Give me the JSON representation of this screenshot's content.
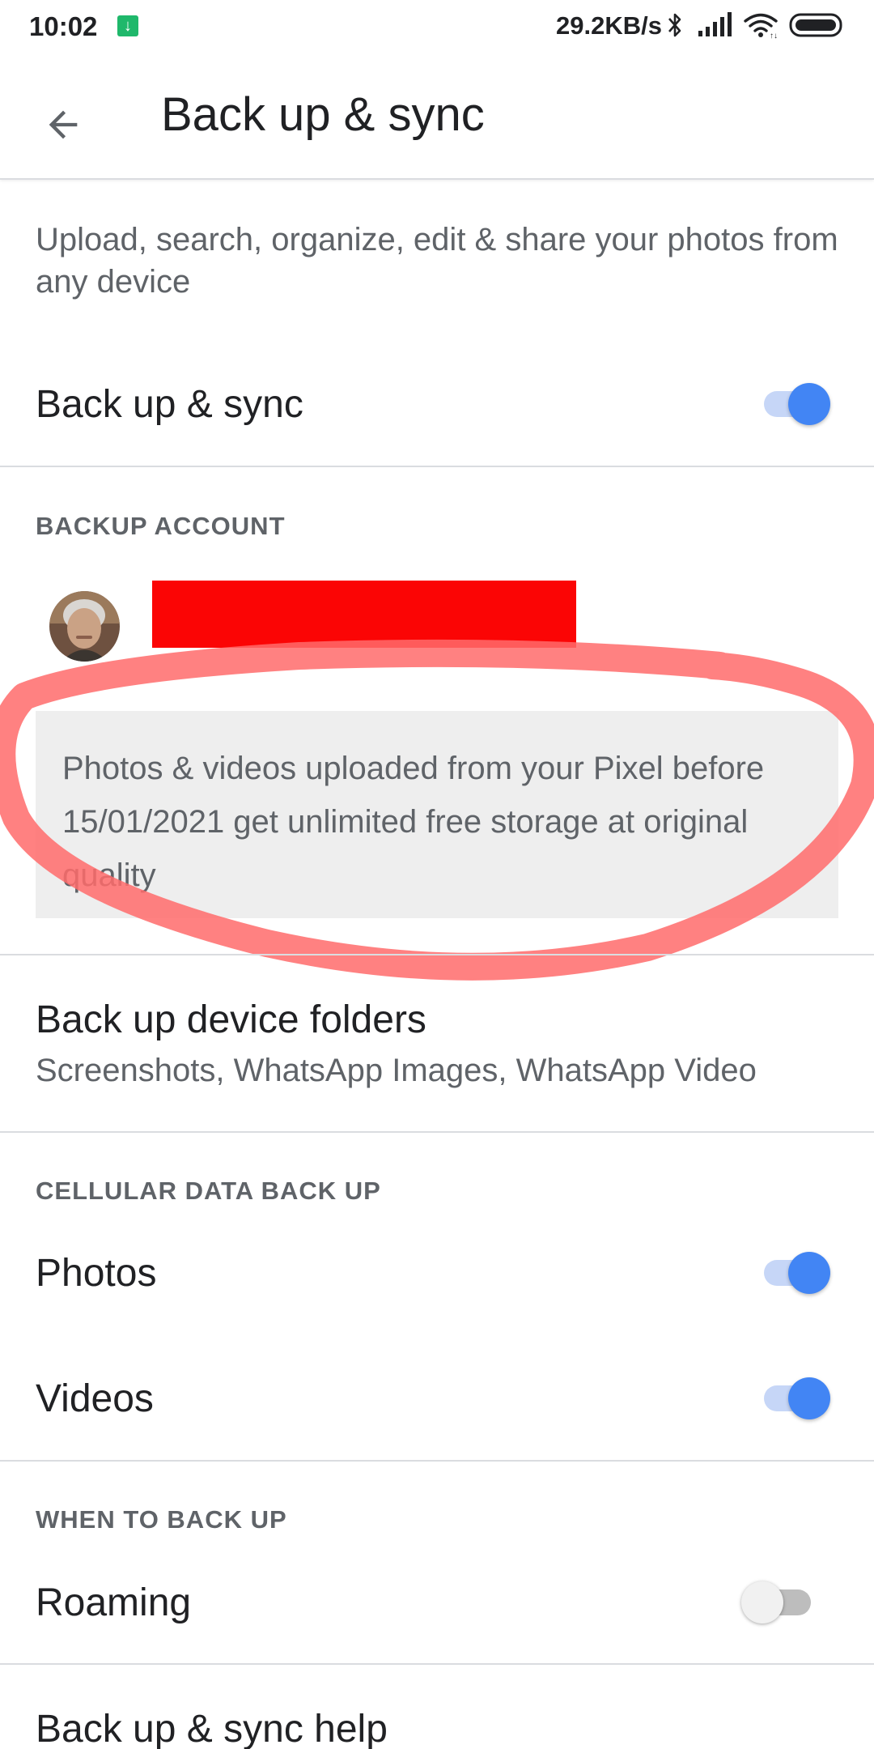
{
  "status_bar": {
    "time": "10:02",
    "network_speed": "29.2KB/s",
    "icons": [
      "download-notification-icon",
      "bluetooth-icon",
      "signal-icon",
      "wifi-icon",
      "battery-icon"
    ]
  },
  "app_bar": {
    "title": "Back up & sync",
    "back_icon": "arrow-back-icon"
  },
  "intro": {
    "description": "Upload, search, organize, edit & share your photos from any device"
  },
  "backup_sync": {
    "label": "Back up & sync",
    "enabled": true
  },
  "backup_account": {
    "header": "BACKUP ACCOUNT",
    "info": "Photos & videos uploaded from your Pixel before 15/01/2021 get unlimited free storage at original quality"
  },
  "device_folders": {
    "title": "Back up device folders",
    "subtitle": "Screenshots, WhatsApp Images, WhatsApp Video"
  },
  "cellular": {
    "header": "CELLULAR DATA BACK UP",
    "photos_label": "Photos",
    "photos_enabled": true,
    "videos_label": "Videos",
    "videos_enabled": true
  },
  "when_to_back_up": {
    "header": "WHEN TO BACK UP",
    "roaming_label": "Roaming",
    "roaming_enabled": false
  },
  "help": {
    "label": "Back up & sync help"
  },
  "colors": {
    "accent": "#4285f4",
    "annotation": "#ff6b6b",
    "redaction": "#fb0505"
  }
}
